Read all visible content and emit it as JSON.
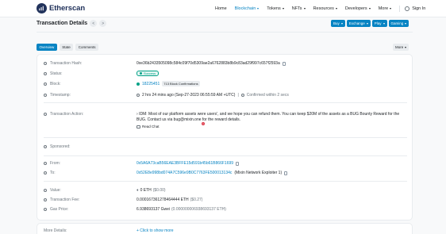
{
  "header": {
    "brand": "Etherscan",
    "nav": [
      {
        "label": "Home",
        "active": false,
        "caret": false
      },
      {
        "label": "Blockchain",
        "active": true,
        "caret": true
      },
      {
        "label": "Tokens",
        "active": false,
        "caret": true
      },
      {
        "label": "NFTs",
        "active": false,
        "caret": true
      },
      {
        "label": "Resources",
        "active": false,
        "caret": true
      },
      {
        "label": "Developers",
        "active": false,
        "caret": true
      },
      {
        "label": "More",
        "active": false,
        "caret": true
      }
    ],
    "sign_in": "Sign In",
    "accent": "#0784c3"
  },
  "page": {
    "title": "Transaction Details",
    "prev": "<",
    "next": ">",
    "actions": [
      "Buy",
      "Exchange",
      "Play",
      "Gaming"
    ]
  },
  "tabs": [
    "Overview",
    "State",
    "Comments"
  ],
  "more_button": "More",
  "tx": {
    "hash": {
      "label": "Transaction Hash:",
      "value": "0xe36b2433505098c584c09f70d5309ae2a6762883b8b9c83ad29f997c657f2593a"
    },
    "status": {
      "label": "Status:",
      "value": "Success"
    },
    "block": {
      "label": "Block:",
      "value": "18225451",
      "confirmations": "713 Block Confirmations"
    },
    "timestamp": {
      "label": "Timestamp:",
      "value": "2 hrs 24 mins ago (Sep-27-2023 06:55:59 AM +UTC)",
      "confirmed": "Confirmed within 2 secs"
    },
    "action": {
      "label": "Transaction Action:",
      "value": "IDM: Most of our platform assets were users', and we hope you can refund them. You can keep $20M of the assets as a BUG Bounty Reward for the BUG. Contact us via bug@mixin.one for the reward details.",
      "read_chat": "Read Chat",
      "notif": "1"
    },
    "sponsored": {
      "label": "Sponsored:"
    },
    "from": {
      "label": "From:",
      "value": "0x5A6A73caB56EAE3BFFE15d591b45b61B866F1699"
    },
    "to": {
      "label": "To:",
      "value": "0x52E8e998bd074A7C596e9B0C7763FE500013134c",
      "tag": "(Mixin Network Exploiter 1)"
    },
    "value": {
      "label": "Value:",
      "value": "0 ETH",
      "usd": "($0.00)"
    },
    "fee": {
      "label": "Transaction Fee:",
      "value": "0.000167361278464444 ETH",
      "usd": "($0.27)"
    },
    "gas": {
      "label": "Gas Price:",
      "value": "6.938693137 Gwei",
      "eth": "(0.000000006938693137 ETH)"
    }
  },
  "more_details": {
    "label": "More Details:",
    "link": "+ Click to show more"
  }
}
